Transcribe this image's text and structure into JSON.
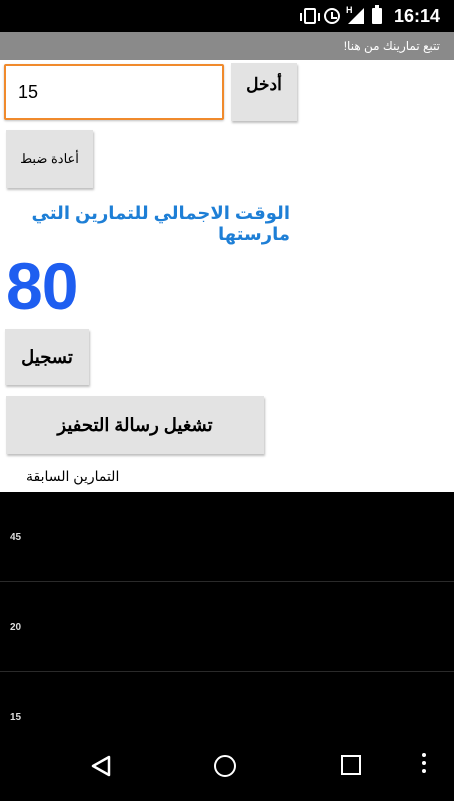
{
  "status_bar": {
    "time": "16:14",
    "network_type": "H",
    "icons": [
      "vibrate-icon",
      "alarm-icon",
      "signal-icon",
      "battery-icon"
    ]
  },
  "app_bar": {
    "title": "تتبع تمارينك من هنا!"
  },
  "entry": {
    "value": "15",
    "enter_label": "أدخل"
  },
  "reset_label": "أعادة ضبط",
  "total": {
    "label": "الوقت الاجمالي للتمارين التي مارستها",
    "value": "80"
  },
  "record_label": "تسجيل",
  "motivation_label": "تشغيل رسالة التحفيز",
  "history": {
    "label": "التمارين السابقة",
    "items": [
      "45",
      "20",
      "15"
    ]
  },
  "nav": {
    "icons": [
      "back-icon",
      "home-icon",
      "recents-icon",
      "overflow-menu-icon"
    ]
  },
  "colors": {
    "field_border": "#f08a2c",
    "label_blue": "#1e7fd6",
    "total_blue": "#1e5ef0",
    "app_bar_gray": "#8a8a8a"
  }
}
